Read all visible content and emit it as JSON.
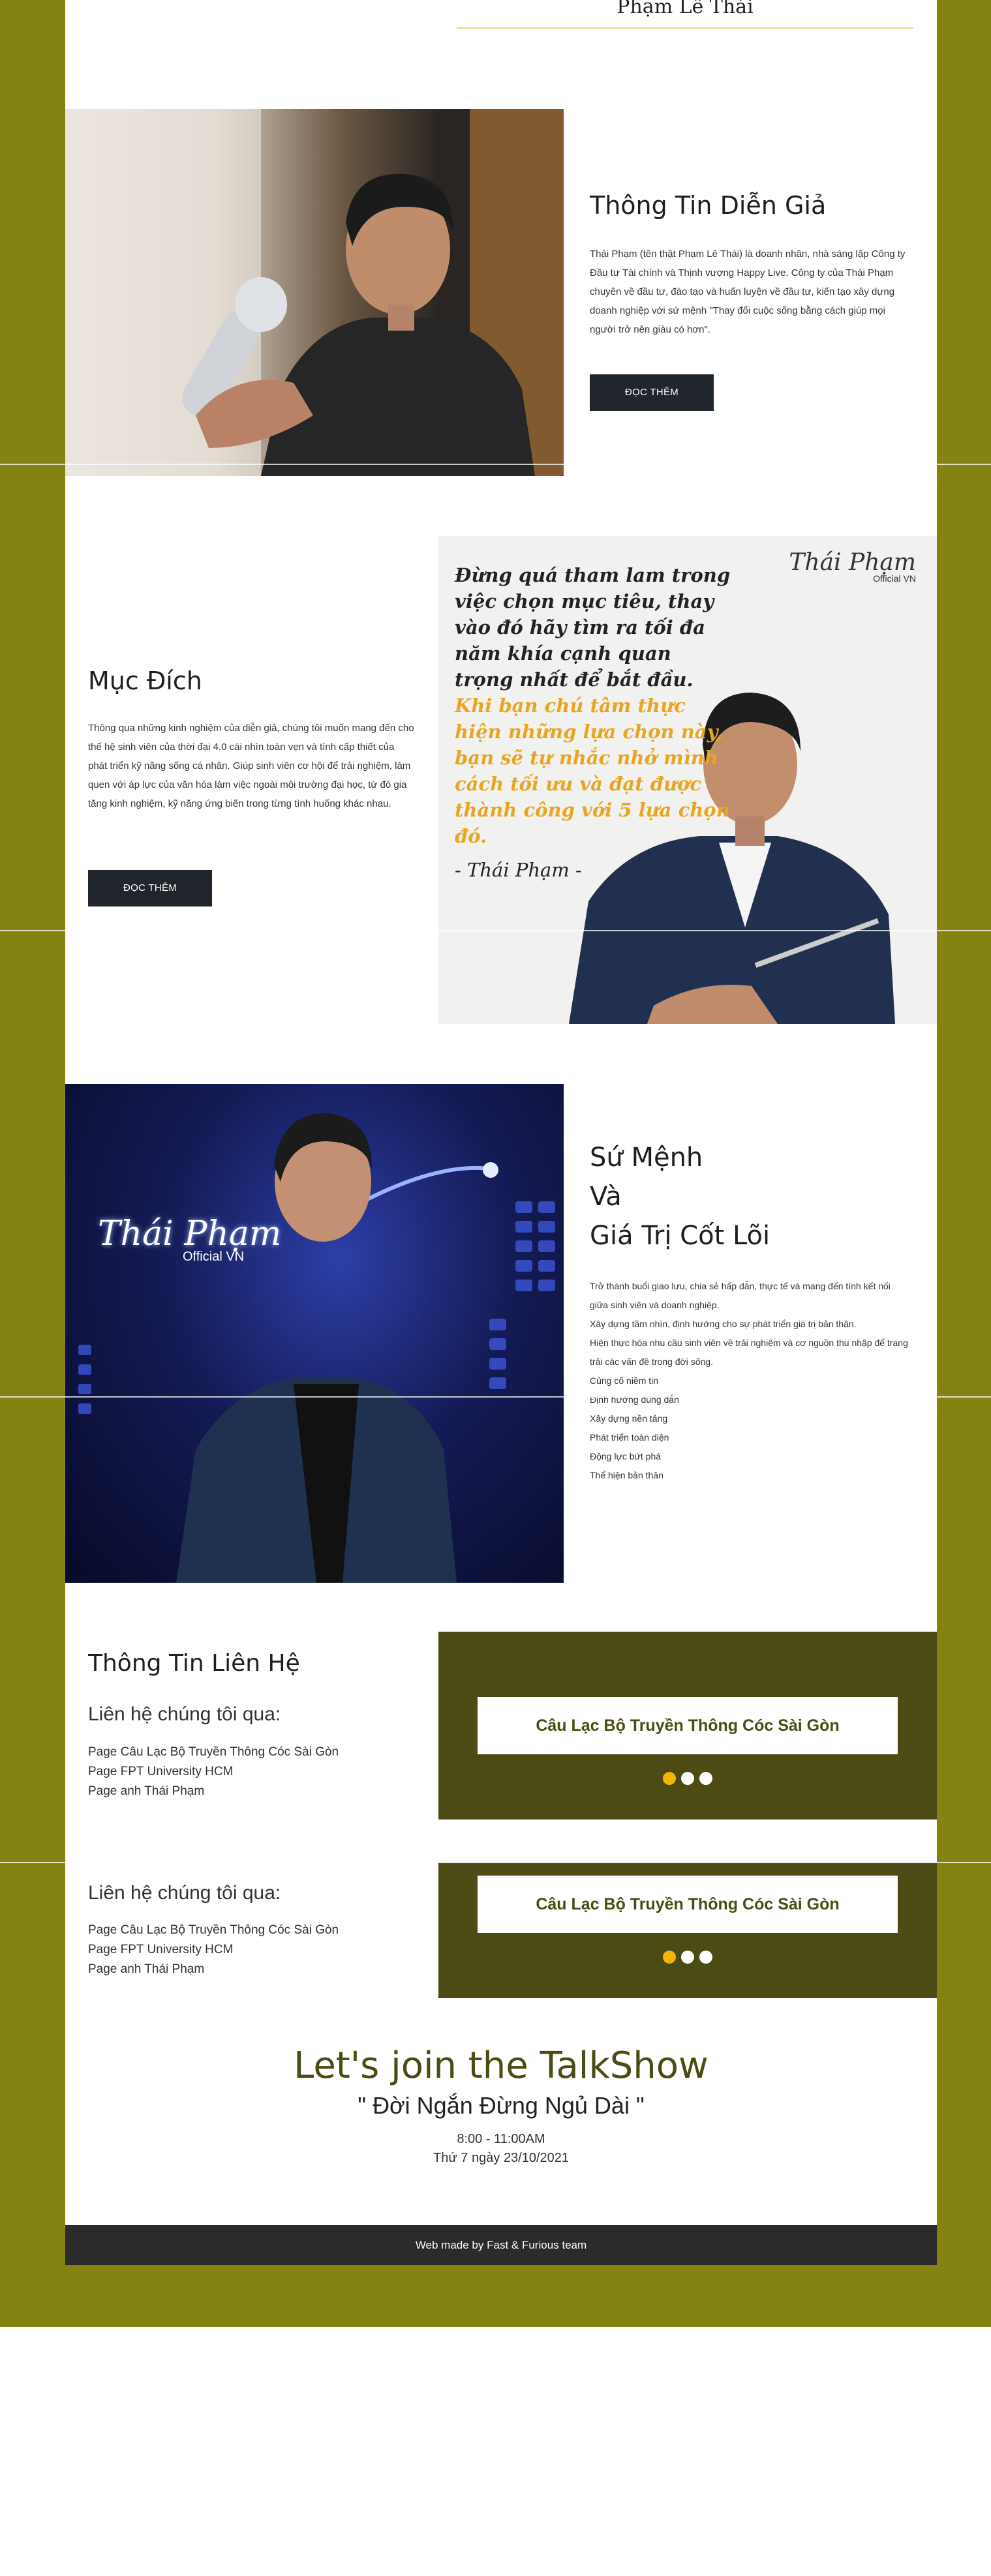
{
  "speaker": {
    "name": "Phạm Lê Thái"
  },
  "about": {
    "title": "Thông Tin Diễn Giả",
    "body": "Thái Phạm (tên thật Phạm Lê Thái) là doanh nhân, nhà sáng lập Công ty Đầu tư Tài chính và Thịnh vượng Happy Live. Công ty của Thái Phạm chuyên về đầu tư, đào tạo và huấn luyện về đầu tư, kiến tạo xây dựng doanh nghiệp với sứ mệnh \"Thay đổi cuộc sống bằng cách giúp mọi người trở nên giàu có hơn\".",
    "button": "ĐỌC THÊM"
  },
  "purpose": {
    "title": "Mục Đích",
    "body": "Thông qua những kinh nghiệm của diễn giả, chúng tôi muốn mang đến cho thế hệ sinh viên của thời đại 4.0 cái nhìn toàn vẹn và tính cấp thiết của phát triển kỹ năng sống cá nhân. Giúp sinh viên cơ hội để trải nghiệm, làm quen với áp lực của văn hóa làm việc ngoài môi trường đại học, từ đó gia tăng kinh nghiệm, kỹ năng ứng biến trong từng tình huống khác nhau.",
    "button": "ĐỌC THÊM",
    "quote": {
      "part1": "Đừng quá tham lam trong việc chọn mục tiêu, thay vào đó hãy tìm ra tối đa năm khía cạnh quan trọng nhất để bắt đầu.",
      "part2": "Khi bạn chú tâm thực hiện những lựa chọn này, bạn sẽ tự nhắc nhở mình cách tối ưu và đạt được thành công với 5 lựa chọn đó.",
      "signature": "- Thái Phạm -",
      "logo_text": "Thái Phạm",
      "logo_sub": "Official VN"
    }
  },
  "mission": {
    "title_line1": "Sứ Mệnh",
    "title_line2": "Và",
    "title_line3": "Giá Trị Cốt Lõi",
    "items": [
      "Trở thành buổi giao lưu, chia sẻ hấp dẫn, thực tế và mang đến tính kết nối giữa sinh viên và doanh nghiệp.",
      "Xây dựng tầm nhìn, định hướng cho sự phát triển giá trị bản thân.",
      "Hiện thực hóa nhu cầu sinh viên về trải nghiệm và cơ nguồn thu nhập để trang trải các vấn đề trong đời sống.",
      "Củng cố niềm tin",
      "Định hướng đúng đắn",
      "Xây dựng nền tảng",
      "Phát triển toàn diện",
      "Động lực bứt phá",
      "Thể hiện bản thân"
    ],
    "logo_text": "Thái Phạm",
    "logo_sub": "Official VN"
  },
  "contact": {
    "title": "Thông Tin Liên Hệ",
    "subtitle": "Liên hệ chúng tôi qua:",
    "links": [
      "Page Câu Lạc Bộ Truyền Thông Cóc Sài Gòn",
      "Page FPT University HCM",
      "Page anh Thái Phạm"
    ],
    "card_label": "Câu Lạc Bộ Truyền Thông Cóc Sài Gòn"
  },
  "contact2": {
    "subtitle": "Liên hệ chúng tôi qua:",
    "links": [
      "Page Câu Lạc Bộ Truyền Thông Cóc Sài Gòn",
      "Page FPT University HCM",
      "Page anh Thái Phạm"
    ],
    "card_label": "Câu Lạc Bộ Truyền Thông Cóc Sài Gòn"
  },
  "talkshow": {
    "title": "Let's join the TalkShow",
    "subtitle": "\" Đời Ngắn Đừng Ngủ Dài \"",
    "time": "8:00 - 11:00AM",
    "date": "Thứ 7 ngày 23/10/2021"
  },
  "footer": {
    "text": "Web made by Fast & Furious team"
  },
  "colors": {
    "olive_background": "#848211",
    "dark_olive": "#4b4b13",
    "accent_gold": "#f2b705",
    "button_dark": "#20262b"
  }
}
